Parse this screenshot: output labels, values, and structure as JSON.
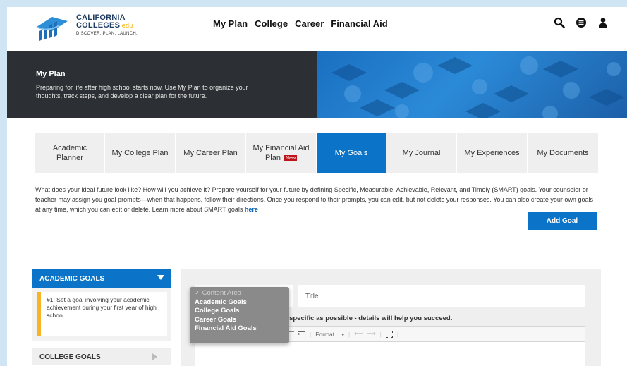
{
  "header": {
    "logo": {
      "line1": "CALIFORNIA",
      "line2": "COLLEGES",
      "line2_suffix": ".edu",
      "tagline": "DISCOVER. PLAN. LAUNCH."
    },
    "nav": [
      "My Plan",
      "College",
      "Career",
      "Financial Aid"
    ],
    "icons": [
      "search-icon",
      "list-icon",
      "user-icon"
    ]
  },
  "hero": {
    "title": "My Plan",
    "description": "Preparing for life after high school starts now. Use My Plan to organize your thoughts, track steps, and develop a clear plan for the future."
  },
  "tabs": [
    {
      "label": "Academic Planner",
      "active": false
    },
    {
      "label": "My College Plan",
      "active": false
    },
    {
      "label": "My Career Plan",
      "active": false
    },
    {
      "label": "My Financial Aid Plan",
      "badge": "New",
      "active": false
    },
    {
      "label": "My Goals",
      "active": true
    },
    {
      "label": "My Journal",
      "active": false
    },
    {
      "label": "My Experiences",
      "active": false
    },
    {
      "label": "My Documents",
      "active": false
    }
  ],
  "intro": {
    "text": "What does your ideal future look like? How will you achieve it? Prepare yourself for your future by defining Specific, Measurable, Achievable, Relevant, and Timely (SMART) goals. Your counselor or teacher may assign you goal prompts—when that happens, follow their directions. Once you respond to their prompts, you can edit, but not delete your responses. You can also create your own goals at any time, which you can edit or delete. Learn more about SMART goals ",
    "link": "here"
  },
  "add_goal_label": "Add Goal",
  "sidebar": {
    "academic_title": "ACADEMIC GOALS",
    "academic_item": "#1: Set a goal involving your academic achievement during your first year of high school.",
    "college_title": "COLLEGE GOALS"
  },
  "form": {
    "title_placeholder": "Title",
    "prompt_visible": "g to do? Be as specific as possible - details will help you succeed.",
    "toolbar_format": "Format"
  },
  "dropdown": {
    "placeholder": "Content Area",
    "options": [
      "Academic Goals",
      "College Goals",
      "Career Goals",
      "Financial Aid Goals"
    ]
  },
  "colors": {
    "accent": "#0b74c8",
    "hero_bg": "#2c2f33",
    "card_accent": "#f6b325",
    "badge": "#c0141c"
  }
}
